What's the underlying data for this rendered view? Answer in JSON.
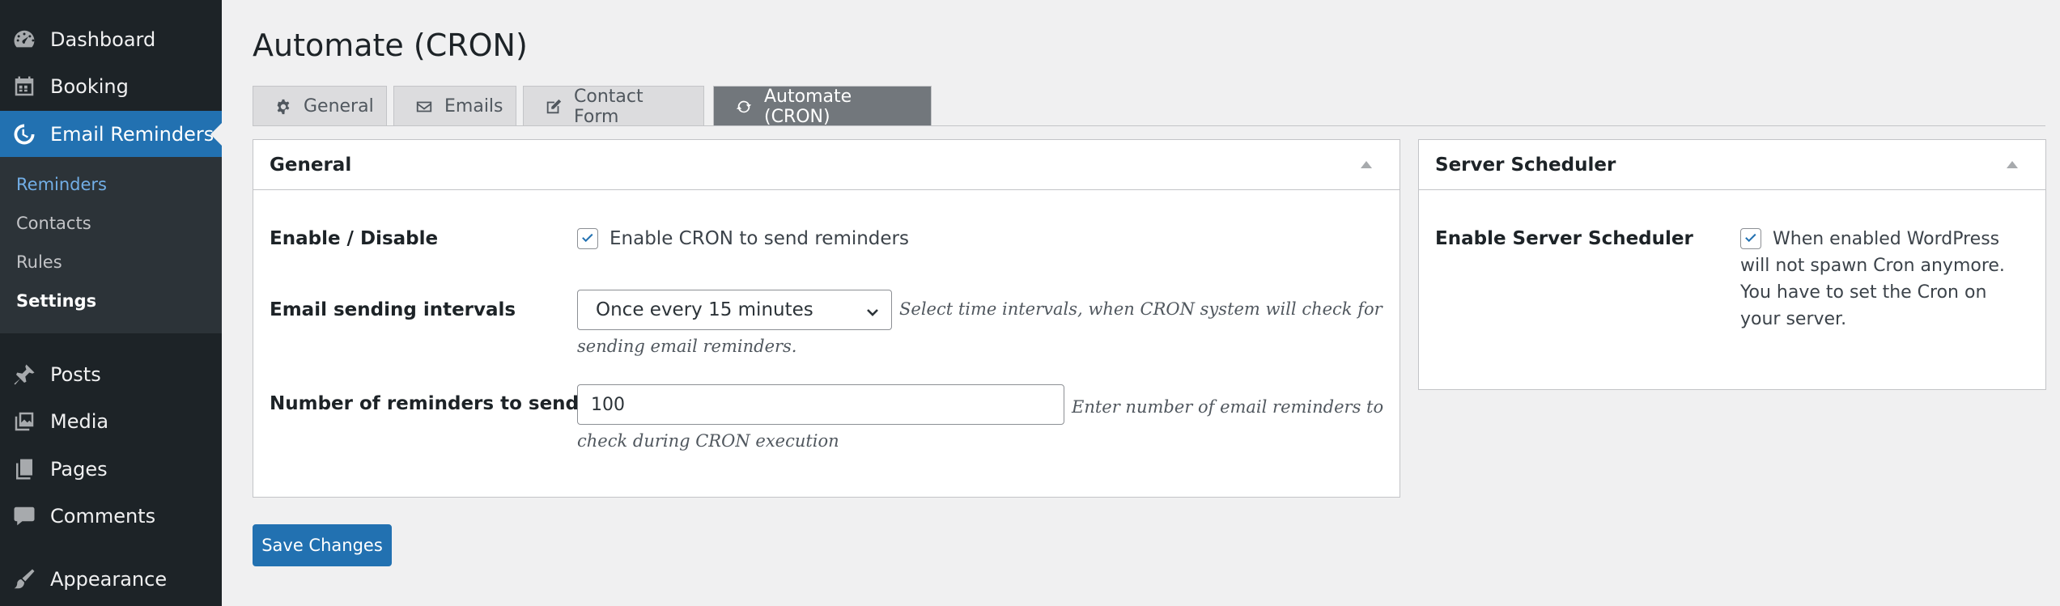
{
  "sidebar": {
    "items": [
      {
        "label": "Dashboard",
        "icon": "dashboard-icon"
      },
      {
        "label": "Booking",
        "icon": "calendar-icon"
      },
      {
        "label": "Email Reminders",
        "icon": "reminder-icon"
      },
      {
        "label": "Posts",
        "icon": "pin-icon"
      },
      {
        "label": "Media",
        "icon": "media-icon"
      },
      {
        "label": "Pages",
        "icon": "pages-icon"
      },
      {
        "label": "Comments",
        "icon": "comment-icon"
      },
      {
        "label": "Appearance",
        "icon": "brush-icon"
      }
    ],
    "submenu": [
      {
        "label": "Reminders"
      },
      {
        "label": "Contacts"
      },
      {
        "label": "Rules"
      },
      {
        "label": "Settings"
      }
    ]
  },
  "page": {
    "title": "Automate (CRON)"
  },
  "tabs": [
    {
      "label": "General",
      "icon": "gear-icon"
    },
    {
      "label": "Emails",
      "icon": "envelope-icon"
    },
    {
      "label": "Contact Form",
      "icon": "edit-icon"
    },
    {
      "label": "Automate (CRON)",
      "icon": "refresh-icon"
    }
  ],
  "general_box": {
    "title": "General",
    "enable_label": "Enable / Disable",
    "enable_checkbox_label": "Enable CRON to send reminders",
    "enable_checked": true,
    "interval_label": "Email sending intervals",
    "interval_value": "Once every 15 minutes",
    "interval_desc_line1": "Select time intervals, when CRON system will check for",
    "interval_desc_line2": "sending email reminders.",
    "number_label": "Number of reminders to send",
    "number_value": "100",
    "number_desc_line1": "Enter number of email reminders to",
    "number_desc_line2": "check during CRON execution"
  },
  "server_box": {
    "title": "Server Scheduler",
    "enable_label": "Enable Server Scheduler",
    "enable_checked": true,
    "text_line1": "When enabled WordPress",
    "text_line2": "will not spawn Cron anymore.",
    "text_line3": "You have to set the Cron on",
    "text_line4": "your server."
  },
  "save_button": {
    "label": "Save Changes"
  },
  "colors": {
    "accent": "#2271b1",
    "sidebar": "#1d2327",
    "submenu": "#2c3338",
    "active_tab": "#72777c"
  }
}
